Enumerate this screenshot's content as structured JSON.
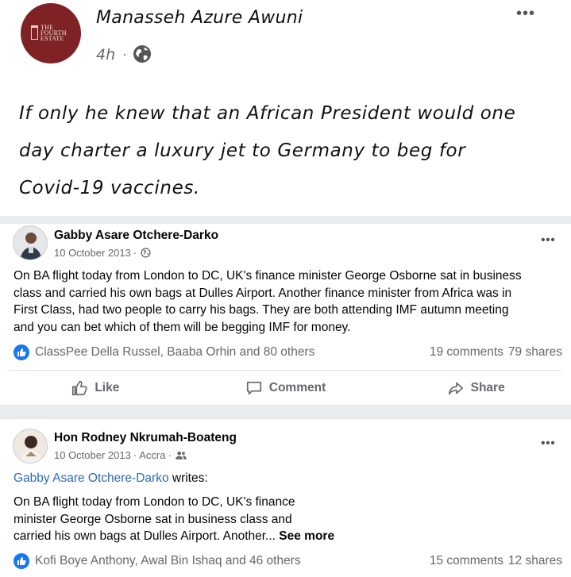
{
  "top_post": {
    "logo_text": [
      "THE",
      "FOURTH",
      "ESTATE"
    ],
    "author": "Manasseh Azure Awuni",
    "time": "4h",
    "dot": "·",
    "menu": "•••",
    "text_lines": [
      "If only he knew that an African President would one",
      "day charter a luxury jet to Germany to beg for",
      "Covid-19 vaccines."
    ]
  },
  "post1": {
    "author": "Gabby Asare Otchere-Darko",
    "date": "10 October 2013",
    "sep": "·",
    "menu": "•••",
    "body_lines": [
      "On BA flight today from London to DC, UK's finance minister George Osborne sat in business",
      "class and carried his own bags at Dulles Airport. Another finance minister from Africa was in",
      "First Class, had two people to carry his bags. They are both attending IMF autumn meeting",
      "and you can bet which of them will be begging IMF for money."
    ],
    "reactions": "ClassPee Della Russel, Baaba Orhin and 80 others",
    "comments": "19 comments",
    "shares": "79 shares",
    "actions": {
      "like": "Like",
      "comment": "Comment",
      "share": "Share"
    }
  },
  "post2": {
    "author": "Hon Rodney Nkrumah-Boateng",
    "date": "10 October 2013",
    "sep": "·",
    "location": "Accra",
    "sep2": "·",
    "menu": "•••",
    "shared_from": "Gabby Asare Otchere-Darko",
    "writes": " writes:",
    "body_lines": [
      "On BA flight today from London to DC, UK's finance",
      "minister George Osborne sat in business class and",
      "carried his own bags at Dulles Airport. Another..."
    ],
    "see_more": "See more",
    "reactions": "Kofi Boye Anthony, Awal Bin Ishaq and 46 others",
    "comments": "15 comments",
    "shares": "12 shares"
  },
  "colors": {
    "accent": "#1a77f2",
    "link": "#2d6ab8",
    "logo_bg": "#7e2226",
    "gap": "#e9ebee"
  }
}
